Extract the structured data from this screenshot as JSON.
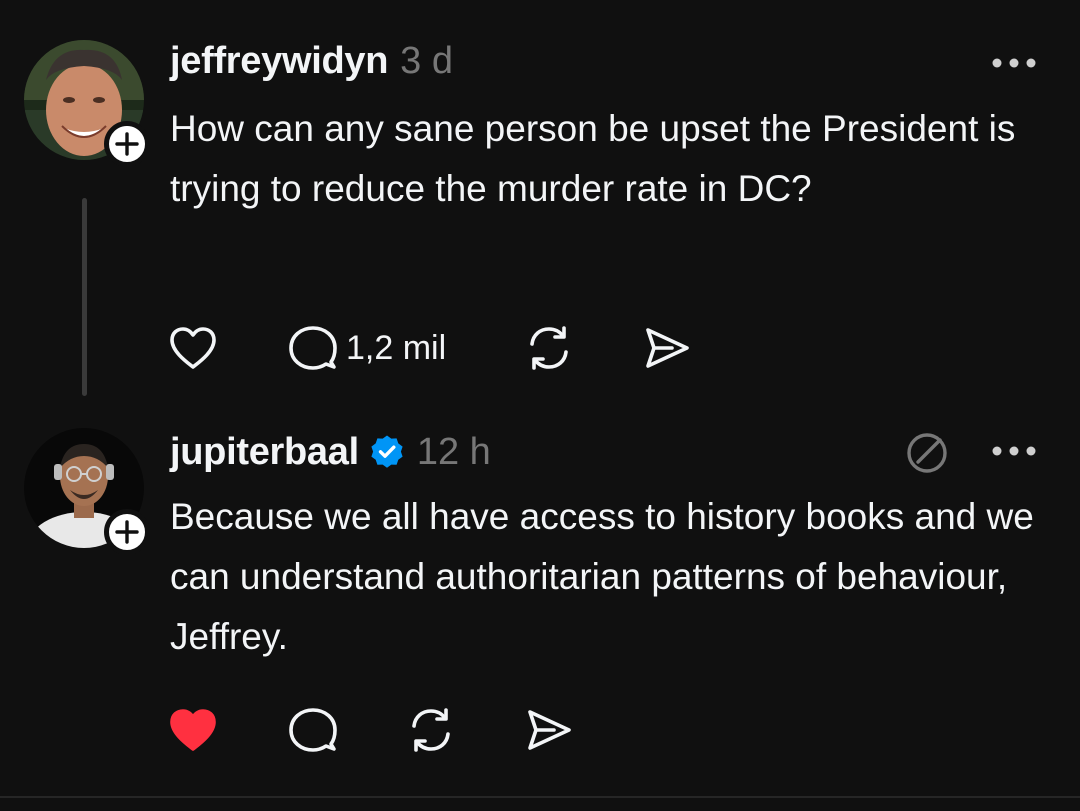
{
  "colors": {
    "background": "#101010",
    "text_primary": "#f3f5f7",
    "text_secondary": "#777777",
    "like_active": "#ff3040",
    "verified_blue": "#0095f6"
  },
  "posts": [
    {
      "username": "jeffreywidyn",
      "timestamp": "3 d",
      "text": "How can any sane person be upset the President is trying to reduce the murder rate in DC?",
      "liked": false,
      "verified": false,
      "reply_count": "1,2 mil",
      "icons": [
        "avatar",
        "follow-plus-icon",
        "more-icon",
        "heart-icon",
        "comment-icon",
        "repost-icon",
        "share-icon"
      ]
    },
    {
      "username": "jupiterbaal",
      "timestamp": "12 h",
      "text": "Because we all have access to history books and we can understand authoritarian patterns of behaviour, Jeffrey.",
      "liked": true,
      "verified": true,
      "icons": [
        "avatar",
        "follow-plus-icon",
        "verified-badge-icon",
        "reply-limit-icon",
        "more-icon",
        "heart-filled-icon",
        "comment-icon",
        "repost-icon",
        "share-icon"
      ]
    }
  ]
}
